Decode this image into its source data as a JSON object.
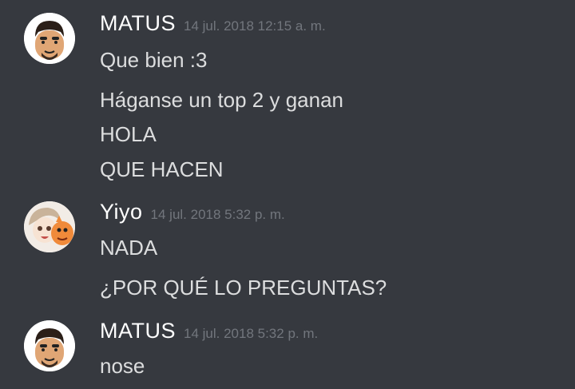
{
  "groups": [
    {
      "username": "MATUS",
      "timestamp": "14 jul. 2018 12:15 a. m.",
      "avatar_icon": "mii-avatar-icon",
      "messages": [
        "Que bien :3",
        "Háganse un top 2 y ganan",
        "HOLA",
        "QUE HACEN"
      ]
    },
    {
      "username": "Yiyo",
      "timestamp": "14 jul. 2018 5:32 p. m.",
      "avatar_icon": "anime-avatar-icon",
      "messages": [
        "NADA",
        "¿POR QUÉ LO PREGUNTAS?"
      ]
    },
    {
      "username": "MATUS",
      "timestamp": "14 jul. 2018 5:32 p. m.",
      "avatar_icon": "mii-avatar-icon",
      "messages": [
        "nose"
      ]
    }
  ],
  "colors": {
    "background": "#36393f",
    "username": "#ffffff",
    "message": "#dcddde",
    "timestamp": "#72767d"
  }
}
